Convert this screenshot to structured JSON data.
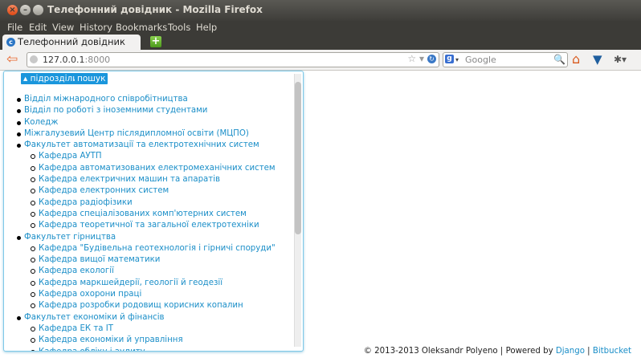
{
  "window": {
    "title": "Телефонний довідник - Mozilla Firefox"
  },
  "menu": {
    "file": "File",
    "edit": "Edit",
    "view": "View",
    "history": "History",
    "bookmarks": "Bookmarks",
    "tools": "Tools",
    "help": "Help"
  },
  "tab": {
    "label": "Телефонний довідник",
    "newtab": "+"
  },
  "nav": {
    "url_host": "127.0.0.1",
    "url_port": ":8000",
    "search_placeholder": "Google"
  },
  "buttons": {
    "subdivisions": "▴ підрозділи",
    "search": "пошук"
  },
  "tree": [
    {
      "label": "Відділ міжнародного співробітництва",
      "level": 1
    },
    {
      "label": "Відділ по роботі з іноземними студентами",
      "level": 1
    },
    {
      "label": "Коледж",
      "level": 1
    },
    {
      "label": "Міжгалузевий Центр післядипломної освіти (МЦПО)",
      "level": 1
    },
    {
      "label": "Факультет автоматизації та електротехнічних систем",
      "level": 1
    },
    {
      "label": "Кафедра АУТП",
      "level": 2
    },
    {
      "label": "Кафедра автоматизованих електромеханічних систем",
      "level": 2
    },
    {
      "label": "Кафедра електричних машин та апаратів",
      "level": 2
    },
    {
      "label": "Кафедра електронних систем",
      "level": 2
    },
    {
      "label": "Кафедра радіофізики",
      "level": 2
    },
    {
      "label": "Кафедра спеціалізованих комп'ютерних систем",
      "level": 2
    },
    {
      "label": "Кафедра теоретичної та загальної електротехніки",
      "level": 2
    },
    {
      "label": "Факультет гірництва",
      "level": 1
    },
    {
      "label": "Кафедра \"Будівельна геотехнологія і гірничі споруди\"",
      "level": 2
    },
    {
      "label": "Кафедра вищої математики",
      "level": 2
    },
    {
      "label": "Кафедра екології",
      "level": 2
    },
    {
      "label": "Кафедра маркшейдерії, геології й геодезії",
      "level": 2
    },
    {
      "label": "Кафедра охорони праці",
      "level": 2
    },
    {
      "label": "Кафедра розробки родовищ корисних копалин",
      "level": 2
    },
    {
      "label": "Факультет економіки й фінансів",
      "level": 1
    },
    {
      "label": "Кафедра ЕК та ІТ",
      "level": 2
    },
    {
      "label": "Кафедра економіки й управління",
      "level": 2
    },
    {
      "label": "Кафедра обліку і аудиту",
      "level": 2
    }
  ],
  "footer": {
    "text": "© 2013-2013 Oleksandr Polyeno | Powered by ",
    "django": "Django",
    "sep": " | ",
    "bitbucket": "Bitbucket"
  }
}
